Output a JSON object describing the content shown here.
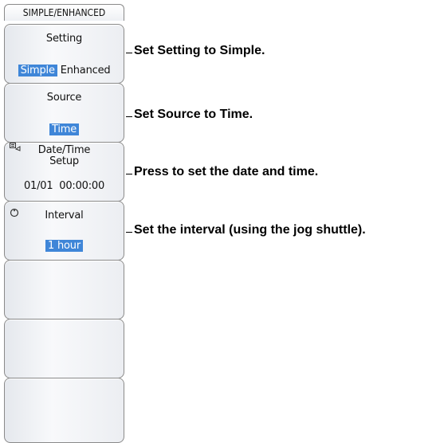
{
  "menu": {
    "title": "SIMPLE/ENHANCED",
    "setting": {
      "label": "Setting",
      "selected": "Simple",
      "other": "Enhanced"
    },
    "source": {
      "label": "Source",
      "value": "Time"
    },
    "datetime": {
      "icon": "datetime-setup-icon",
      "label_line1": "Date/Time",
      "label_line2": "Setup",
      "value": "01/01  00:00:00"
    },
    "interval": {
      "icon": "jog-dial-icon",
      "label": "Interval",
      "value": "1 hour"
    }
  },
  "callouts": {
    "setting": "Set Setting to Simple.",
    "source": "Set Source to Time.",
    "datetime": "Press to set the date and time.",
    "interval": "Set the interval (using the jog shuttle)."
  },
  "colors": {
    "highlight": "#3f86d8",
    "border": "#8a8a8a"
  }
}
